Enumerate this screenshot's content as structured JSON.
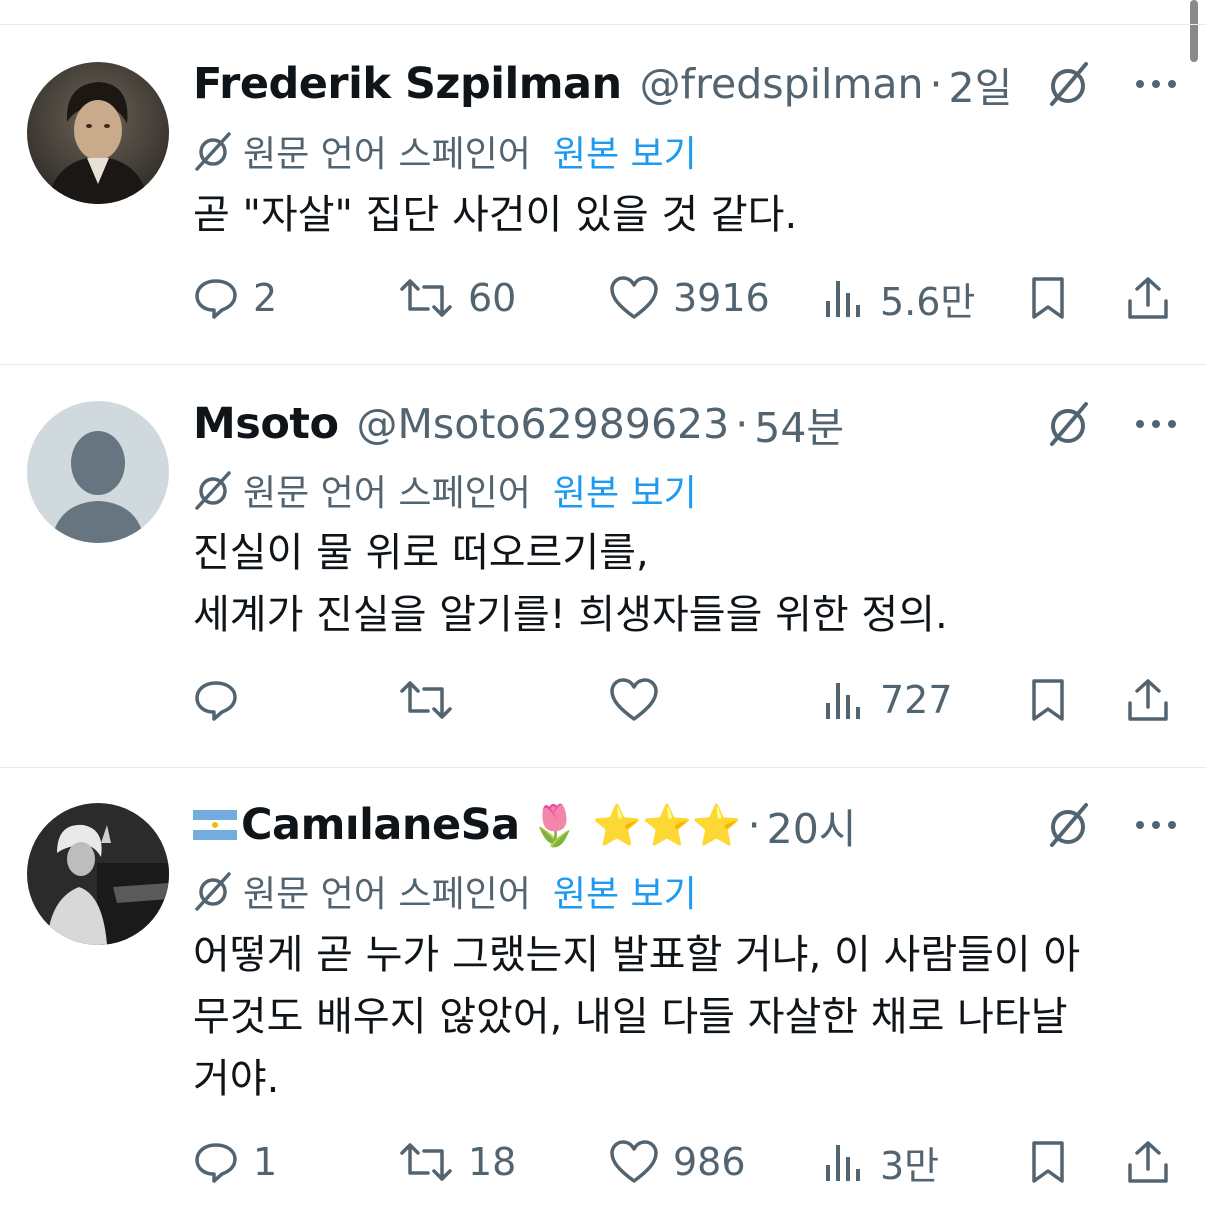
{
  "tweets": [
    {
      "name": "Frederik Szpilman",
      "handle": "@fredspilman",
      "time": "2일",
      "has_flag": false,
      "emoji": "",
      "avatar_icon": "portrait-avatar",
      "translate_label": "원문 언어 스페인어",
      "show_original": "원본 보기",
      "text": [
        "곧 \"자살\" 집단 사건이 있을 것 같다."
      ],
      "replies": "2",
      "reposts": "60",
      "likes": "3916",
      "views": "5.6만"
    },
    {
      "name": "Msoto",
      "handle": "@Msoto62989623",
      "time": "54분",
      "has_flag": false,
      "emoji": "",
      "avatar_icon": "default-avatar",
      "translate_label": "원문 언어 스페인어",
      "show_original": "원본 보기",
      "text": [
        "진실이 물 위로 떠오르기를,",
        "세계가 진실을 알기를! 희생자들을 위한 정의."
      ],
      "replies": "",
      "reposts": "",
      "likes": "",
      "views": "727"
    },
    {
      "name": "CamılaneSa",
      "handle": "",
      "time": "20시",
      "has_flag": true,
      "emoji": "🌷 ⭐⭐⭐",
      "avatar_icon": "singer-photo-avatar",
      "translate_label": "원문 언어 스페인어",
      "show_original": "원본 보기",
      "text": [
        "어떻게 곧 누가 그랬는지 발표할 거냐, 이 사람들이 아",
        "무것도 배우지 않았어, 내일 다들 자살한 채로 나타날",
        "거야."
      ],
      "replies": "1",
      "reposts": "18",
      "likes": "986",
      "views": "3만"
    }
  ],
  "colors": {
    "text": "#0f1419",
    "secondary": "#536471",
    "link": "#1d9bf0",
    "divider": "#e6ecf0"
  }
}
